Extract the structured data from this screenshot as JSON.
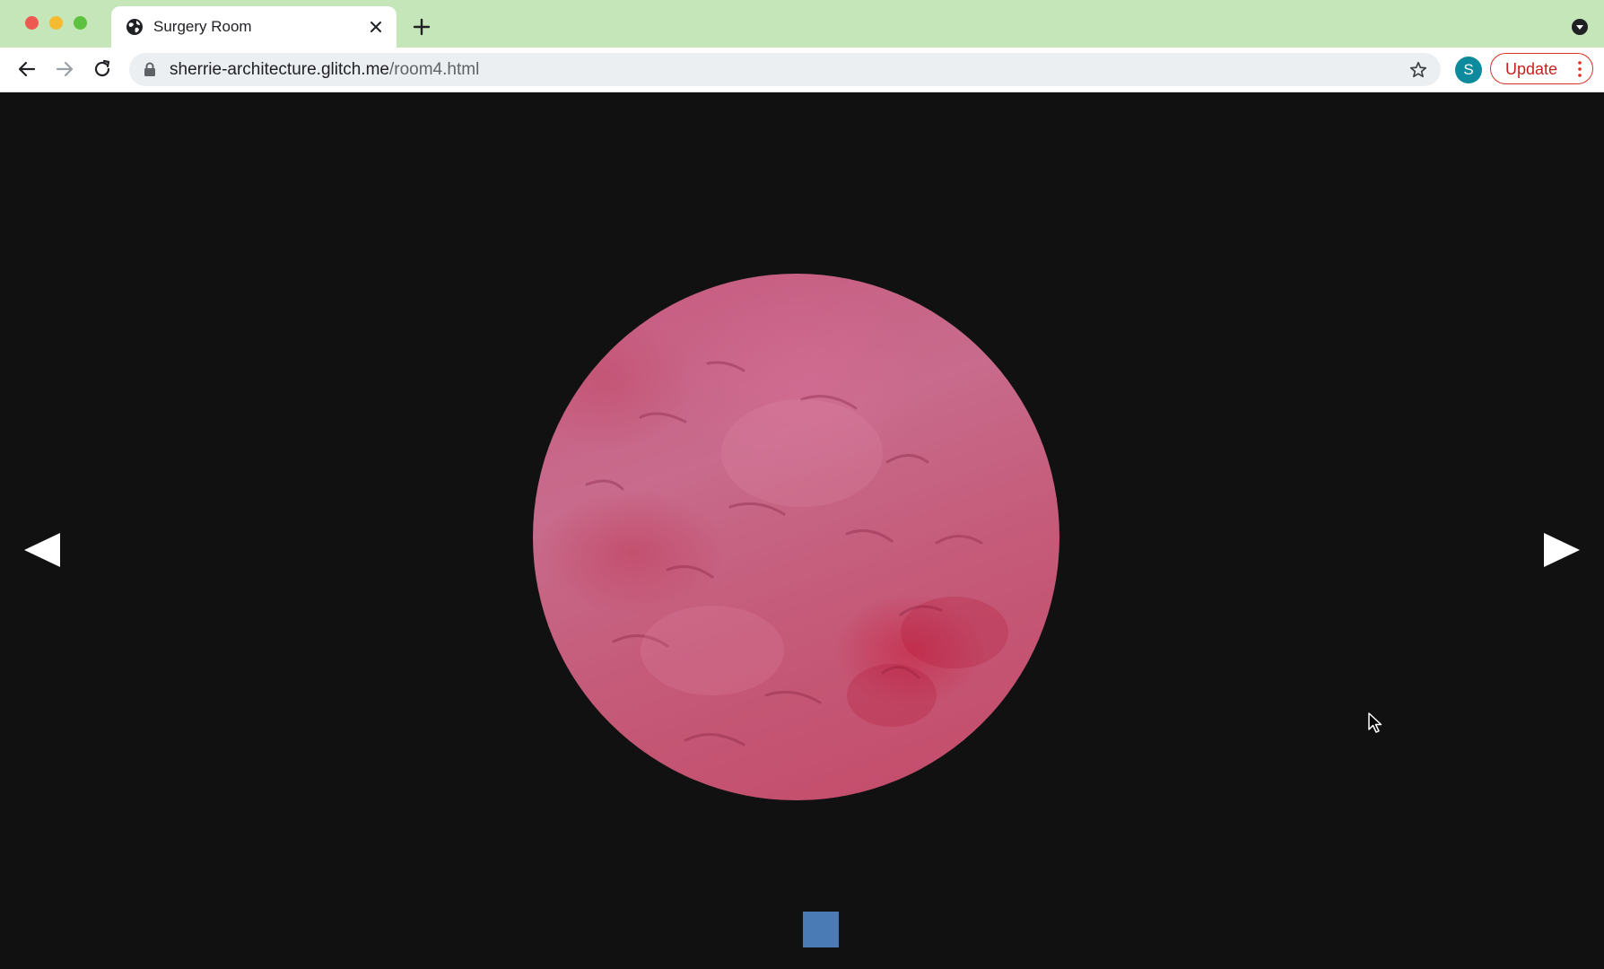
{
  "browser": {
    "tab": {
      "title": "Surgery Room"
    },
    "address_bar": {
      "host": "sherrie-architecture.glitch.me",
      "path": "/room4.html"
    },
    "profile_initial": "S",
    "update_label": "Update"
  },
  "page": {
    "background_color": "#111111",
    "image": "tissue-texture-circle",
    "nav": {
      "prev_icon": "triangle-left-icon",
      "next_icon": "triangle-right-icon"
    },
    "indicator_color": "#4a7bb5"
  },
  "colors": {
    "tab_strip": "#c4e6b8",
    "update_accent": "#d93025",
    "profile": "#0d8a9c"
  }
}
